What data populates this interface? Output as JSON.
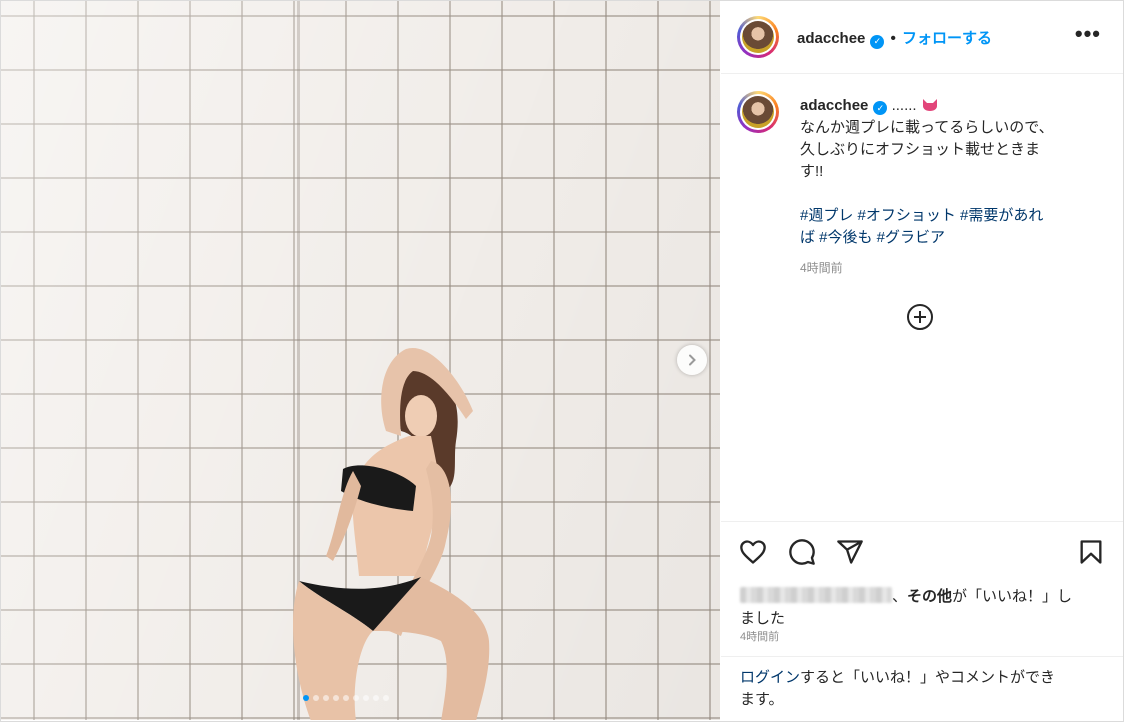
{
  "post": {
    "username": "adacchee",
    "dot": "•",
    "follow_label": "フォローする",
    "more_label": "•••",
    "caption_user": "adacchee",
    "caption_tail": "......",
    "caption_line1": "なんか週プレに載ってるらしいので、",
    "caption_line2": "久しぶりにオフショット載せときま",
    "caption_line3": "す!!",
    "hashtags_line1": "#週プレ #オフショット #需要があれ",
    "hashtags_line2": "ば #今後も #グラビア",
    "caption_time": "4時間前",
    "likes_others": "その他",
    "likes_suffix": "が「いいね！」し",
    "likes_line2": "ました",
    "likes_time": "4時間前",
    "login_link": "ログイン",
    "login_suffix": "すると「いいね！」やコメントができ",
    "login_line2": "ます。"
  },
  "carousel": {
    "count": 9,
    "active_index": 0
  },
  "colors": {
    "accent": "#0095f6",
    "link": "#00376b",
    "muted": "#8e8e8e"
  }
}
